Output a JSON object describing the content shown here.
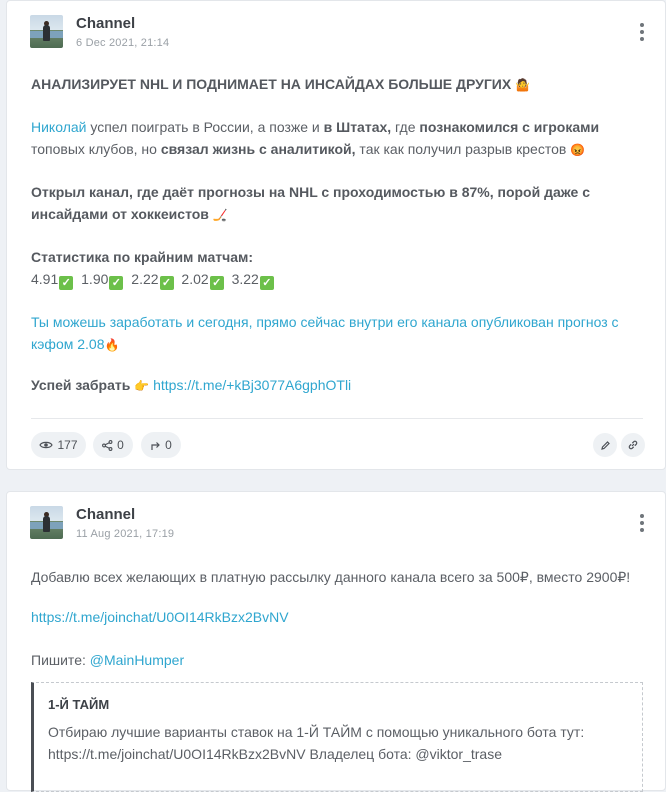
{
  "posts": [
    {
      "channel": "Channel",
      "date": "6 Dec 2021, 21:14",
      "headline": "АНАЛИЗИРУЕТ NHL И ПОДНИМАЕТ НА ИНСАЙДАХ БОЛЬШЕ ДРУГИХ",
      "p2": {
        "name_link": "Николай",
        "t1": " успел поиграть в России, а позже и ",
        "b1": "в Штатах,",
        "t2": " где ",
        "b2": "познакомился с игроками",
        "t3": " топовых клубов, но ",
        "b3": "связал жизнь с аналитикой,",
        "t4": " так как получил разрыв крестов"
      },
      "p3": "Открыл канал, где даёт прогнозы на NHL с проходимостью в 87%, порой даже с инсайдами от хоккеистов",
      "stats_title": "Статистика по крайним матчам:",
      "stats": [
        "4.91",
        "1.90",
        "2.22",
        "2.02",
        "3.22"
      ],
      "p5": "Ты можешь заработать и сегодня, прямо сейчас внутри его канала опубликован прогноз с кэфом 2.08",
      "cta_label": "Успей забрать",
      "cta_link": "https://t.me/+kBj3077A6gphOTli",
      "views": "177",
      "shares": "0",
      "forwards": "0"
    },
    {
      "channel": "Channel",
      "date": "11 Aug 2021, 17:19",
      "line1": "Добавлю всех желающих в платную рассылку данного канала всего за 500₽, вместо 2900₽!",
      "link": "https://t.me/joinchat/U0OI14RkBzx2BvNV",
      "write_label": "Пишите: ",
      "write_handle": "@MainHumper",
      "quote_title": "1-Й ТАЙМ",
      "quote_text": "Отбираю лучшие варианты ставок на 1-Й ТАЙМ с помощью уникального бота тут: https://t.me/joinchat/U0OI14RkBzx2BvNV Владелец бота: @viktor_trase"
    }
  ],
  "icons": {
    "headline_emoji": "🤷",
    "angry_emoji": "😡",
    "hockey_emoji": "🏒",
    "fire_emoji": "🔥",
    "point_emoji": "👉",
    "check": "✓"
  },
  "colors": {
    "link": "#2fa6cf",
    "check": "#6cc04a"
  }
}
